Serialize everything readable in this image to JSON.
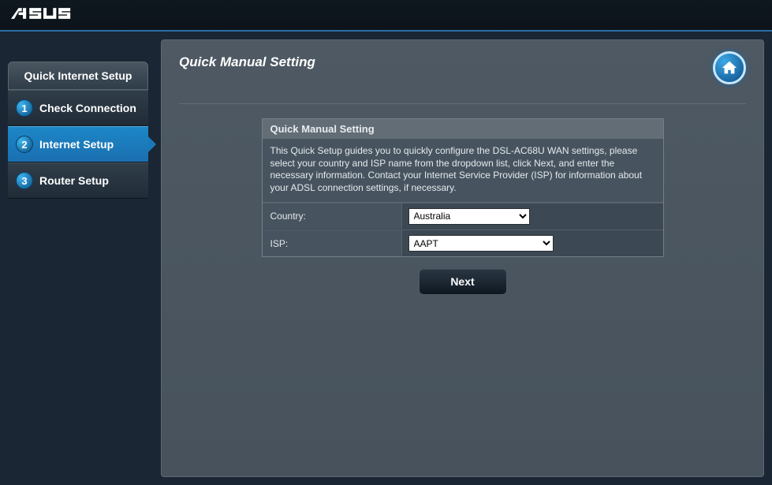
{
  "brand": "ASUS",
  "sidebar": {
    "title": "Quick Internet Setup",
    "steps": [
      {
        "num": "1",
        "label": "Check Connection"
      },
      {
        "num": "2",
        "label": "Internet Setup"
      },
      {
        "num": "3",
        "label": "Router Setup"
      }
    ],
    "active_index": 1
  },
  "page": {
    "title": "Quick Manual Setting",
    "panel_title": "Quick Manual Setting",
    "description": "This Quick Setup guides you to quickly configure the DSL-AC68U WAN settings, please select your country and ISP name from the dropdown list, click Next, and enter the necessary information. Contact your Internet Service Provider (ISP) for information about your ADSL connection settings, if necessary."
  },
  "form": {
    "country_label": "Country:",
    "country_value": "Australia",
    "isp_label": "ISP:",
    "isp_value": "AAPT"
  },
  "buttons": {
    "next": "Next"
  }
}
